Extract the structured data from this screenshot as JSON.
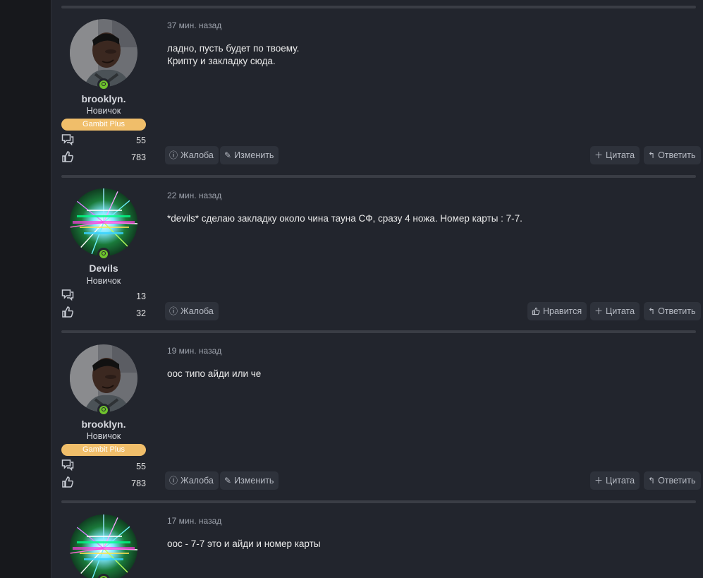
{
  "posts": [
    {
      "time": "37 мин. назад",
      "message": "ладно, пусть будет по твоему.\nКрипту и закладку сюда.",
      "author": {
        "name": "brooklyn.",
        "rank": "Новичок",
        "badge": "Gambit Plus",
        "messages": "55",
        "likes": "783",
        "avatar": "portrait"
      },
      "actions": {
        "report": "Жалоба",
        "edit": "Изменить",
        "quote": "Цитата",
        "reply": "Ответить"
      }
    },
    {
      "time": "22 мин. назад",
      "message": "*devils* сделаю закладку около чина тауна СФ, сразу 4 ножа. Номер карты : 7-7.",
      "author": {
        "name": "Devils",
        "rank": "Новичок",
        "messages": "13",
        "likes": "32",
        "avatar": "glitch"
      },
      "actions": {
        "report": "Жалоба",
        "like": "Нравится",
        "quote": "Цитата",
        "reply": "Ответить"
      }
    },
    {
      "time": "19 мин. назад",
      "message": "оос типо айди или че",
      "author": {
        "name": "brooklyn.",
        "rank": "Новичок",
        "badge": "Gambit Plus",
        "messages": "55",
        "likes": "783",
        "avatar": "portrait"
      },
      "actions": {
        "report": "Жалоба",
        "edit": "Изменить",
        "quote": "Цитата",
        "reply": "Ответить"
      }
    },
    {
      "time": "17 мин. назад",
      "message": "оос - 7-7 это и айди и номер карты",
      "author": {
        "avatar": "glitch"
      }
    }
  ],
  "colors": {
    "badge": "#f0be6a",
    "online": "#6fc22d",
    "background": "#22252d",
    "button": "#2e323b"
  }
}
